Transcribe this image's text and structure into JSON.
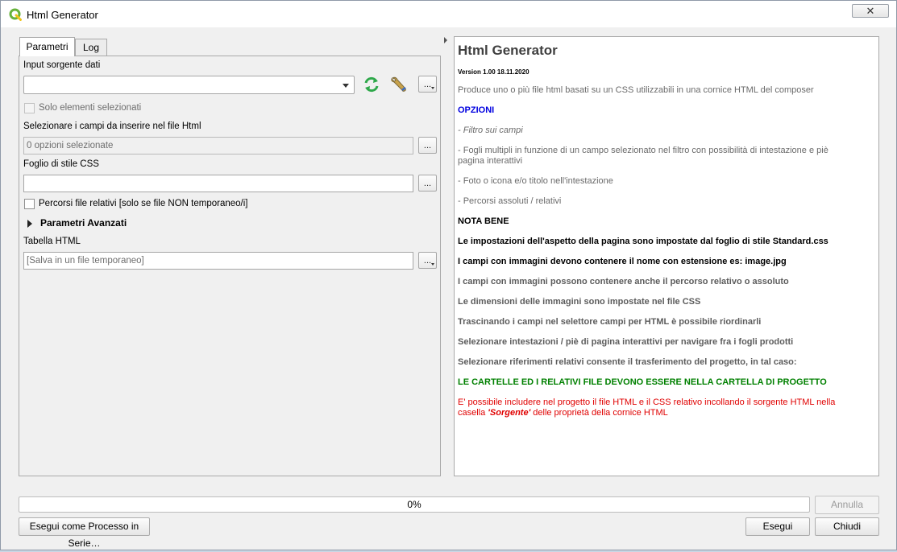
{
  "window": {
    "title": "Html Generator",
    "close_glyph": "✕"
  },
  "tabs": [
    {
      "label": "Parametri",
      "active": true
    },
    {
      "label": "Log",
      "active": false
    }
  ],
  "params": {
    "input_label": "Input sorgente dati",
    "input_value": "",
    "only_selected_label": "Solo elementi selezionati",
    "fields_label": "Selezionare i campi da inserire nel file Html",
    "fields_value": "0 opzioni selezionate",
    "css_label": "Foglio di stile CSS",
    "css_value": "",
    "relative_paths_label": "Percorsi file relativi [solo se  file NON temporaneo/i]",
    "advanced_label": "Parametri Avanzati",
    "table_label": "Tabella HTML",
    "table_value": "[Salva in un file temporaneo]",
    "dots": "..."
  },
  "help": {
    "title": "Html Generator",
    "version": "Version 1.00 18.11.2020",
    "intro": "Produce uno o più file html basati su un CSS utilizzabili in una cornice HTML del composer",
    "options_heading": "OPZIONI",
    "opt1": "- Filtro sui campi",
    "opt2": "- Fogli multipli in funzione di un campo selezionato nel filtro con possibilità di intestazione e piè pagina interattivi",
    "opt3": "- Foto o icona e/o titolo nell'intestazione",
    "opt4": "- Percorsi assoluti / relativi",
    "note_heading": "NOTA BENE",
    "note1": "Le impostazioni dell'aspetto della pagina sono impostate dal foglio di stile Standard.css",
    "note2": "I campi con immagini devono contenere il nome con estensione es: image.jpg",
    "note3": "I campi con immagini possono contenere anche il percorso relativo o assoluto",
    "note4": "Le dimensioni delle immagini sono impostate nel file CSS",
    "note5": "Trascinando i campi nel selettore campi per HTML è possibile riordinarli",
    "note6": "Selezionare intestazioni / piè di pagina interattivi per navigare fra i fogli prodotti",
    "note7": "Selezionare riferimenti relativi consente il trasferimento del progetto, in tal caso:",
    "warning": "LE CARTELLE ED I RELATIVI FILE DEVONO ESSERE NELLA CARTELLA DI PROGETTO",
    "red_line1": "E' possibile includere nel progetto il file HTML e il CSS relativo incollando il sorgente HTML nella",
    "red_line2_a": "casella ",
    "red_line2_b": "'Sorgente'",
    "red_line2_c": " delle proprietà della cornice HTML"
  },
  "progress": {
    "value": 0,
    "label": "0%"
  },
  "buttons": {
    "cancel": "Annulla",
    "batch": "Esegui come Processo in Serie…",
    "run": "Esegui",
    "close": "Chiudi"
  },
  "colors": {
    "options_heading": "#0000e0",
    "warning": "#008000",
    "red_note": "#e00000",
    "refresh_icon": "#2ea84a"
  },
  "icons": [
    "qgis-logo-icon",
    "refresh-icon",
    "wrench-icon",
    "triangle-right-icon",
    "chevron-down-icon"
  ]
}
